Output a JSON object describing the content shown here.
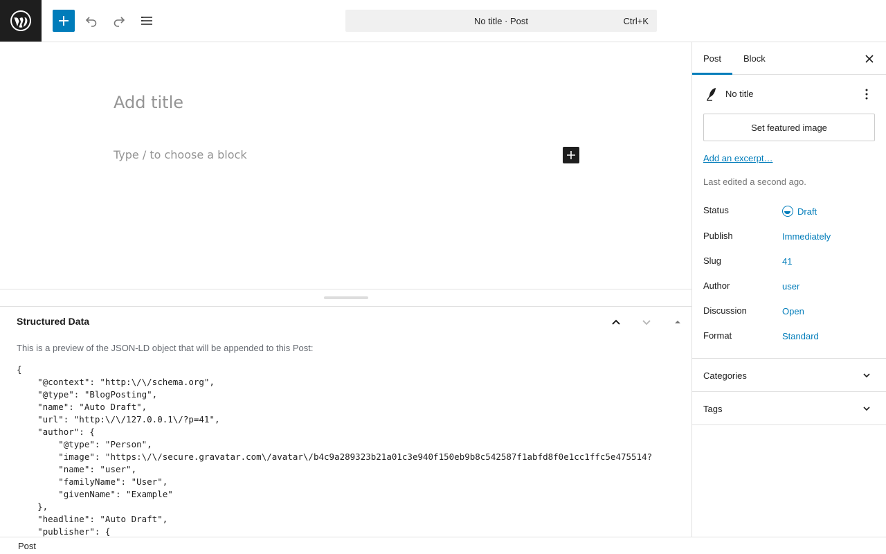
{
  "header": {
    "add_icon": "plus-icon",
    "undo_icon": "undo-icon",
    "redo_icon": "redo-icon",
    "list_icon": "list-view-icon",
    "command_bar": {
      "label": "No title · Post",
      "shortcut": "Ctrl+K"
    }
  },
  "editor": {
    "title_placeholder": "Add title",
    "block_placeholder": "Type / to choose a block"
  },
  "meta_box": {
    "title": "Structured Data",
    "description": "This is a preview of the JSON-LD object that will be appended to this Post:",
    "json_lines": [
      "{",
      "    \"@context\": \"http:\\/\\/schema.org\",",
      "    \"@type\": \"BlogPosting\",",
      "    \"name\": \"Auto Draft\",",
      "    \"url\": \"http:\\/\\/127.0.0.1\\/?p=41\",",
      "    \"author\": {",
      "        \"@type\": \"Person\",",
      "        \"image\": \"https:\\/\\/secure.gravatar.com\\/avatar\\/b4c9a289323b21a01c3e940f150eb9b8c542587f1abfd8f0e1cc1ffc5e475514?",
      "        \"name\": \"user\",",
      "        \"familyName\": \"User\",",
      "        \"givenName\": \"Example\"",
      "    },",
      "    \"headline\": \"Auto Draft\",",
      "    \"publisher\": {"
    ]
  },
  "footer": {
    "breadcrumb": "Post"
  },
  "sidebar": {
    "tabs": [
      {
        "label": "Post"
      },
      {
        "label": "Block"
      }
    ],
    "post_title": "No title",
    "featured_image_button": "Set featured image",
    "excerpt_link": "Add an excerpt…",
    "last_edited": "Last edited a second ago.",
    "rows": [
      {
        "label": "Status",
        "value": "Draft"
      },
      {
        "label": "Publish",
        "value": "Immediately"
      },
      {
        "label": "Slug",
        "value": "41"
      },
      {
        "label": "Author",
        "value": "user"
      },
      {
        "label": "Discussion",
        "value": "Open"
      },
      {
        "label": "Format",
        "value": "Standard"
      }
    ],
    "panels": [
      {
        "title": "Categories"
      },
      {
        "title": "Tags"
      }
    ]
  },
  "colors": {
    "accent": "#007cba",
    "dark": "#1e1e1e",
    "border": "#e0e0e0"
  }
}
